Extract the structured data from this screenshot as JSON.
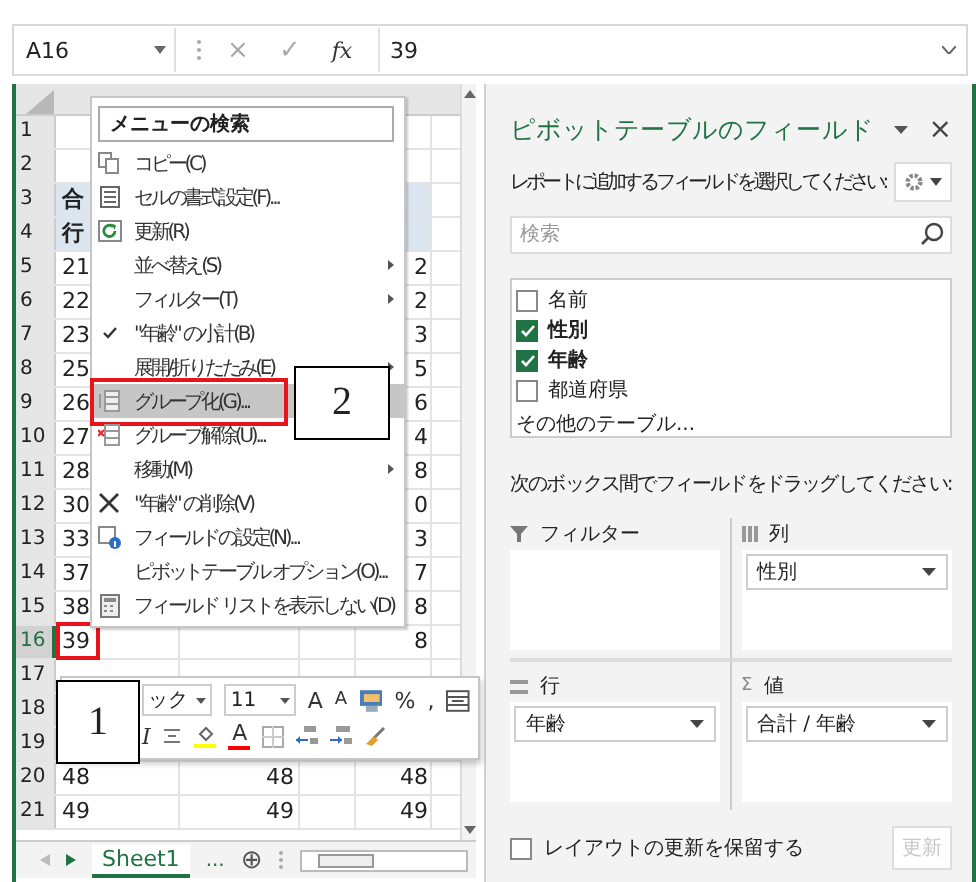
{
  "formula_bar": {
    "name_box": "A16",
    "cancel": "×",
    "enter": "✓",
    "function": "fx",
    "value": "39"
  },
  "sheet": {
    "rows": [
      {
        "header": "1",
        "a": "",
        "b": "",
        "d": "",
        "selected": false,
        "kind": "plain"
      },
      {
        "header": "2",
        "a": "",
        "b": "",
        "d": "",
        "selected": false,
        "kind": "plain"
      },
      {
        "header": "3",
        "a": "合",
        "b": "",
        "d": "",
        "selected": false,
        "kind": "pivot-header"
      },
      {
        "header": "4",
        "a": "行",
        "b": "",
        "d": "",
        "selected": false,
        "kind": "pivot-header"
      },
      {
        "header": "5",
        "a": "21",
        "b": "",
        "d": "2",
        "selected": false,
        "kind": "plain"
      },
      {
        "header": "6",
        "a": "22",
        "b": "",
        "d": "2",
        "selected": false,
        "kind": "plain"
      },
      {
        "header": "7",
        "a": "23",
        "b": "",
        "d": "3",
        "selected": false,
        "kind": "plain"
      },
      {
        "header": "8",
        "a": "25",
        "b": "",
        "d": "5",
        "selected": false,
        "kind": "plain"
      },
      {
        "header": "9",
        "a": "26",
        "b": "",
        "d": "6",
        "selected": false,
        "kind": "plain"
      },
      {
        "header": "10",
        "a": "27",
        "b": "",
        "d": "4",
        "selected": false,
        "kind": "plain"
      },
      {
        "header": "11",
        "a": "28",
        "b": "",
        "d": "8",
        "selected": false,
        "kind": "plain"
      },
      {
        "header": "12",
        "a": "30",
        "b": "",
        "d": "0",
        "selected": false,
        "kind": "plain"
      },
      {
        "header": "13",
        "a": "33",
        "b": "",
        "d": "3",
        "selected": false,
        "kind": "plain"
      },
      {
        "header": "14",
        "a": "37",
        "b": "",
        "d": "7",
        "selected": false,
        "kind": "plain"
      },
      {
        "header": "15",
        "a": "38",
        "b": "",
        "d": "8",
        "selected": false,
        "kind": "plain"
      },
      {
        "header": "16",
        "a": "39",
        "b": "",
        "d": "8",
        "selected": true,
        "kind": "plain"
      },
      {
        "header": "17",
        "a": "",
        "b": "",
        "d": "",
        "selected": false,
        "kind": "plain"
      },
      {
        "header": "18",
        "a": "",
        "b": "",
        "d": "",
        "selected": false,
        "kind": "plain"
      },
      {
        "header": "19",
        "a": "",
        "b": "",
        "d": "",
        "selected": false,
        "kind": "plain"
      },
      {
        "header": "20",
        "a": "48",
        "b": "48",
        "d": "48",
        "selected": false,
        "kind": "plain"
      },
      {
        "header": "21",
        "a": "49",
        "b": "49",
        "d": "49",
        "selected": false,
        "kind": "plain"
      }
    ],
    "tabs": [
      {
        "label": "Sheet1",
        "selected": true
      }
    ],
    "more": "...",
    "add": "⊕"
  },
  "context_menu": {
    "search_placeholder": "メニューの検索",
    "items": [
      {
        "label": "コピー(C)",
        "kind": "copy",
        "submenu": false,
        "checked": false,
        "selected": false
      },
      {
        "label": "セルの書式設定(F)...",
        "kind": "format",
        "submenu": false,
        "checked": false,
        "selected": false
      },
      {
        "label": "更新(R)",
        "kind": "refresh",
        "submenu": false,
        "checked": false,
        "selected": false
      },
      {
        "label": "並べ替え(S)",
        "kind": "plain",
        "submenu": true,
        "checked": false,
        "selected": false
      },
      {
        "label": "フィルター(T)",
        "kind": "plain",
        "submenu": true,
        "checked": false,
        "selected": false
      },
      {
        "label": "\"年齢\" の小計(B)",
        "kind": "plain",
        "submenu": false,
        "checked": true,
        "selected": false
      },
      {
        "label": "展開/折りたたみ(E)",
        "kind": "plain",
        "submenu": true,
        "checked": false,
        "selected": false
      },
      {
        "label": "グループ化(G)...",
        "kind": "group",
        "submenu": false,
        "checked": false,
        "selected": true
      },
      {
        "label": "グループ解除(U)...",
        "kind": "ungroup",
        "submenu": false,
        "checked": false,
        "selected": false
      },
      {
        "label": "移動(M)",
        "kind": "plain",
        "submenu": true,
        "checked": false,
        "selected": false
      },
      {
        "label": "\"年齢\" の削除(V)",
        "kind": "delete",
        "submenu": false,
        "checked": false,
        "selected": false
      },
      {
        "label": "フィールドの設定(N)...",
        "kind": "settings",
        "submenu": false,
        "checked": false,
        "selected": false
      },
      {
        "label": "ピボットテーブル オプション(O)...",
        "kind": "plain",
        "submenu": false,
        "checked": false,
        "selected": false
      },
      {
        "label": "フィールド リストを表示しない(D)",
        "kind": "hide-list",
        "submenu": false,
        "checked": false,
        "selected": false
      }
    ]
  },
  "mini_toolbar": {
    "font_controls": [
      {
        "kind": "font-field",
        "label": "ック"
      },
      {
        "kind": "size-field",
        "label": "11"
      },
      {
        "kind": "grow",
        "label": "A"
      },
      {
        "kind": "shrink",
        "label": "A"
      },
      {
        "kind": "styles"
      },
      {
        "kind": "percent",
        "label": "%"
      },
      {
        "kind": "comma",
        "label": ","
      },
      {
        "kind": "merge"
      }
    ],
    "format_controls": [
      {
        "kind": "italic",
        "label": "I"
      },
      {
        "kind": "align"
      },
      {
        "kind": "fill-color",
        "color": "#ffff00"
      },
      {
        "kind": "font-color",
        "label": "A",
        "color": "#ff0000"
      },
      {
        "kind": "borders"
      },
      {
        "kind": "inc-decimal"
      },
      {
        "kind": "dec-decimal"
      },
      {
        "kind": "brush"
      }
    ]
  },
  "callouts": [
    {
      "label": "1"
    },
    {
      "label": "2"
    }
  ],
  "pivot_pane": {
    "title": "ピボットテーブルのフィールド",
    "close": "×",
    "instruction": "レポートに追加するフィールドを選択してください:",
    "search_placeholder": "検索",
    "fields": [
      {
        "label": "名前",
        "checked": false
      },
      {
        "label": "性別",
        "checked": true
      },
      {
        "label": "年齢",
        "checked": true
      },
      {
        "label": "都道府県",
        "checked": false
      }
    ],
    "more_tables": "その他のテーブル...",
    "drag_hint": "次のボックス間でフィールドをドラッグしてください:",
    "areas": [
      {
        "kind": "filter",
        "label": "フィルター"
      },
      {
        "kind": "columns",
        "label": "列",
        "items": [
          "性別"
        ]
      },
      {
        "kind": "rows",
        "label": "行",
        "items": [
          "年齢"
        ]
      },
      {
        "kind": "values",
        "symbol": "Σ",
        "label": "値",
        "items": [
          "合計 / 年齢"
        ]
      }
    ],
    "defer_update": {
      "label": "レイアウトの更新を保留する",
      "checked": false
    },
    "update_button": {
      "label": "更新",
      "disabled": true
    }
  }
}
